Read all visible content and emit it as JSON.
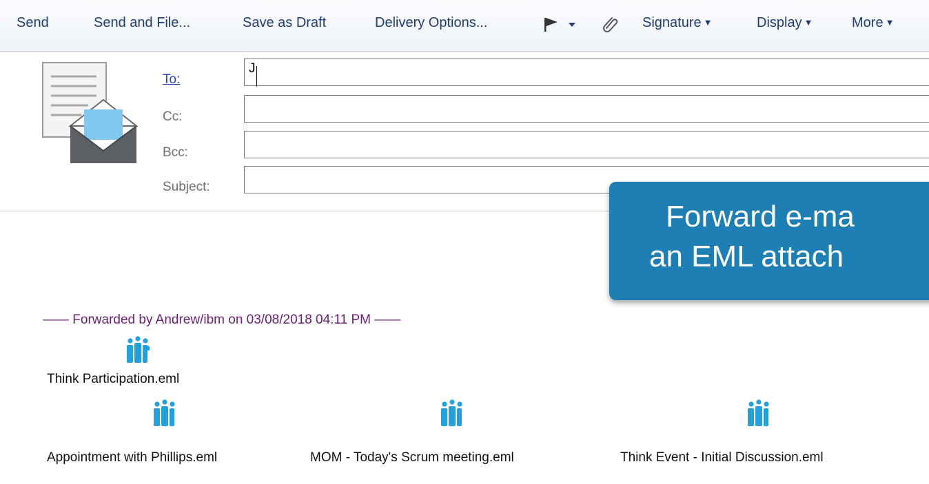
{
  "toolbar": {
    "send": "Send",
    "send_and_file": "Send and File...",
    "save_as_draft": "Save as Draft",
    "delivery_options": "Delivery Options...",
    "signature": "Signature",
    "display": "Display",
    "more": "More"
  },
  "header": {
    "to_label": "To:",
    "cc_label": "Cc:",
    "bcc_label": "Bcc:",
    "subject_label": "Subject:",
    "to_value": "J",
    "cc_value": "",
    "bcc_value": "",
    "subject_value": ""
  },
  "body": {
    "forwarded_line": "—— Forwarded by Andrew/ibm on 03/08/2018 04:11 PM ——",
    "attachments": [
      {
        "name": "Think Participation.eml",
        "icon": "lotus-notes-icon"
      },
      {
        "name": "Appointment with Phillips.eml",
        "icon": "lotus-notes-icon"
      },
      {
        "name": "MOM - Today's Scrum meeting.eml",
        "icon": "lotus-notes-icon"
      },
      {
        "name": "Think Event - Initial Discussion.eml",
        "icon": "lotus-notes-icon"
      }
    ]
  },
  "callout": {
    "line1": "Forward e-ma",
    "line2": "an EML attach"
  },
  "colors": {
    "callout_bg": "#1d7fb4",
    "toolbar_text": "#1f3d73",
    "forward_line": "#6b1e75",
    "link": "#2545c8"
  }
}
